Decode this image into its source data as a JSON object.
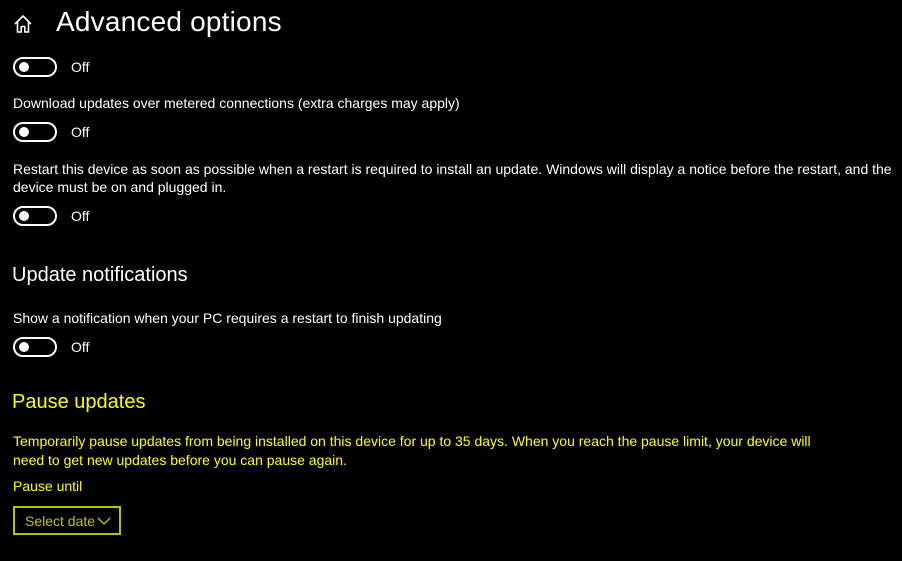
{
  "header": {
    "home_icon": "home-icon",
    "title": "Advanced options"
  },
  "settings": [
    {
      "state": "Off"
    },
    {
      "label": "Download updates over metered connections (extra charges may apply)",
      "state": "Off"
    },
    {
      "label": "Restart this device as soon as possible when a restart is required to install an update. Windows will display a notice before the restart, and the device must be on and plugged in.",
      "state": "Off"
    }
  ],
  "update_notifications": {
    "heading": "Update notifications",
    "label": "Show a notification when your PC requires a restart to finish updating",
    "state": "Off"
  },
  "pause_updates": {
    "heading": "Pause updates",
    "description": "Temporarily pause updates from being installed on this device for up to 35 days. When you reach the pause limit, your device will need to get new updates before you can pause again.",
    "pause_until_label": "Pause until",
    "select_placeholder": "Select date",
    "chevron_icon": "chevron-down-icon"
  },
  "colors": {
    "background": "#000000",
    "text": "#ffffff",
    "highlight": "#ffff00"
  }
}
